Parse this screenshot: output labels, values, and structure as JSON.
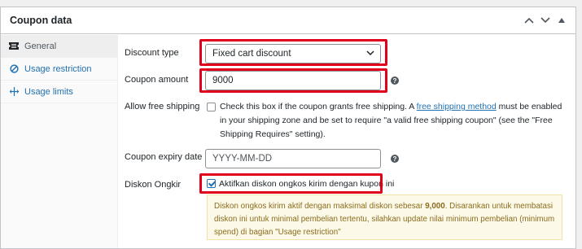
{
  "panel": {
    "title": "Coupon data"
  },
  "sidebar": {
    "items": [
      {
        "label": "General",
        "icon": "ticket-icon",
        "active": true
      },
      {
        "label": "Usage restriction",
        "icon": "ban-icon",
        "active": false
      },
      {
        "label": "Usage limits",
        "icon": "limits-icon",
        "active": false
      }
    ]
  },
  "form": {
    "discount_type": {
      "label": "Discount type",
      "value": "Fixed cart discount"
    },
    "coupon_amount": {
      "label": "Coupon amount",
      "value": "9000"
    },
    "free_shipping": {
      "label": "Allow free shipping",
      "text_before": "Check this box if the coupon grants free shipping. A ",
      "link": "free shipping method",
      "text_after": " must be enabled in your shipping zone and be set to require \"a valid free shipping coupon\" (see the \"Free Shipping Requires\" setting).",
      "checked": false
    },
    "expiry": {
      "label": "Coupon expiry date",
      "placeholder": "YYYY-MM-DD"
    },
    "diskon_ongkir": {
      "label": "Diskon Ongkir",
      "checkbox_label": "Aktifkan diskon ongkos kirim dengan kupon ini",
      "checked": true
    },
    "notice": {
      "text_before": "Diskon ongkos kirim aktif dengan maksimal diskon sebesar ",
      "amount": "9,000",
      "text_after": ". Disarankan untuk membatasi diskon ini untuk minimal pembelian tertentu, silahkan update nilai minimum pembelian (minimum spend) di bagian \"Usage restriction\""
    }
  },
  "colors": {
    "highlight": "#e0001b",
    "link": "#2271b1",
    "notice_bg": "#fcf9e8"
  }
}
